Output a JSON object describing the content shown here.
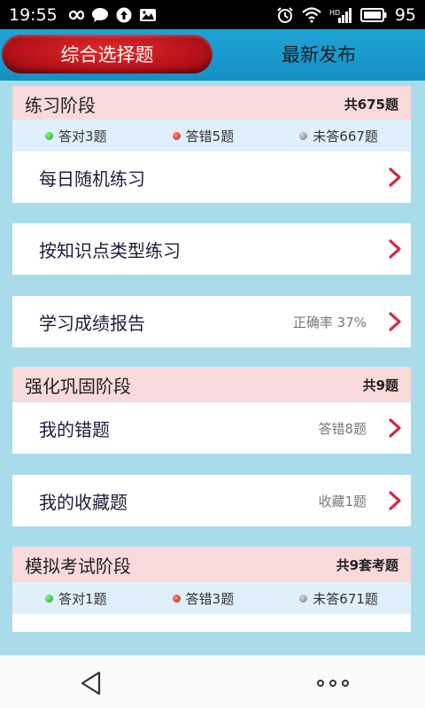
{
  "status_bar": {
    "time": "19:55",
    "battery": "95",
    "icons": [
      "infinity-icon",
      "chat-bubble-icon",
      "upload-circle-icon",
      "image-icon",
      "alarm-icon",
      "wifi-icon",
      "signal-icon",
      "battery-icon"
    ]
  },
  "tabs": [
    {
      "label": "综合选择题",
      "active": true
    },
    {
      "label": "最新发布",
      "active": false
    }
  ],
  "sections": {
    "practice": {
      "title": "练习阶段",
      "count": "共675题",
      "stats": {
        "correct": "答对3题",
        "wrong": "答错5题",
        "unanswered": "未答667题"
      },
      "items": [
        {
          "label": "每日随机练习",
          "note": ""
        },
        {
          "label": "按知识点类型练习",
          "note": ""
        },
        {
          "label": "学习成绩报告",
          "note": "正确率 37%"
        }
      ]
    },
    "reinforce": {
      "title": "强化巩固阶段",
      "count": "共9题",
      "items": [
        {
          "label": "我的错题",
          "note": "答错8题"
        },
        {
          "label": "我的收藏题",
          "note": "收藏1题"
        }
      ]
    },
    "exam": {
      "title": "模拟考试阶段",
      "count": "共9套考题",
      "stats": {
        "correct": "答对1题",
        "wrong": "答错3题",
        "unanswered": "未答671题"
      }
    }
  },
  "colors": {
    "tab_active": "#c0141c",
    "header_blue": "#1a9bd0",
    "section_bg": "#f9dada",
    "stats_bg": "#dff0fa",
    "chevron": "#c8304a",
    "page_bg": "#a9dcea"
  }
}
